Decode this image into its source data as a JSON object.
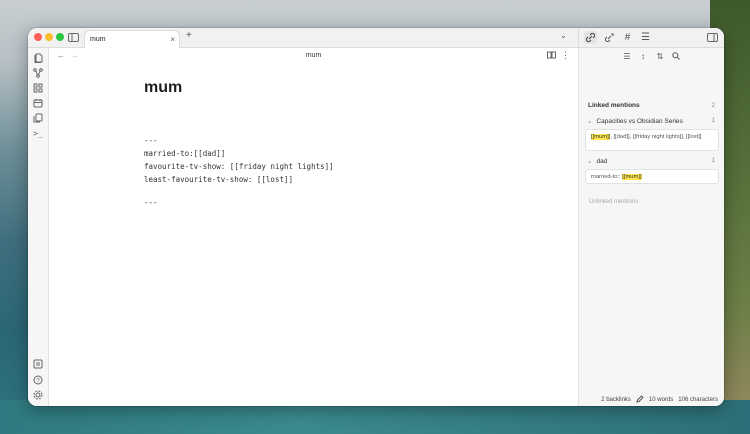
{
  "tab": {
    "title": "mum",
    "close": "×",
    "new_tab": "+",
    "menu": "⌄"
  },
  "note": {
    "header_title": "mum",
    "heading": "mum",
    "frontmatter_open": "---",
    "lines": [
      "married-to:[[dad]]",
      "favourite-tv-show: [[friday night lights]]",
      "least-favourite-tv-show: [[lost]]"
    ],
    "frontmatter_close": "---"
  },
  "backlinks": {
    "linked_title": "Linked mentions",
    "linked_count": "2",
    "files": [
      {
        "name": "Capacities vs Obsidian Series",
        "count": "1",
        "snippet_hl": "[[mum]]",
        "snippet_rest": ", [[dad]], [[friday night lights]], [[lost]]"
      },
      {
        "name": "dad",
        "count": "1",
        "snippet_pre": "married-to:: ",
        "snippet_hl": "[[mum]]"
      }
    ],
    "unlinked_title": "Unlinked mentions"
  },
  "status": {
    "backlinks": "2 backlinks",
    "words": "10 words",
    "characters": "106 characters"
  },
  "icons": {
    "back": "←",
    "forward": "→",
    "more": "⋮",
    "reading": "▯▯",
    "chevron": "⌄"
  }
}
